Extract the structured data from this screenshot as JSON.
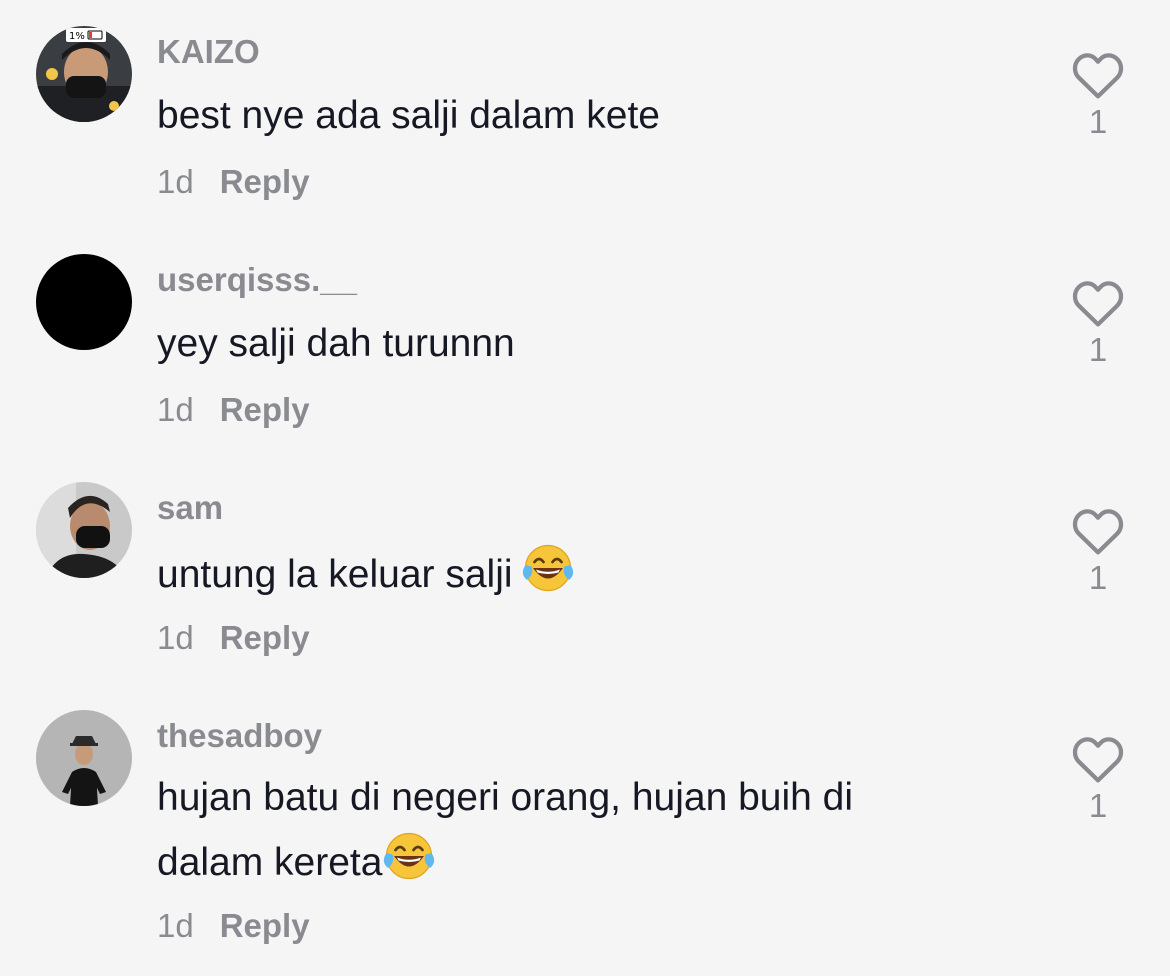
{
  "comments": [
    {
      "username": "KAIZO",
      "text": "best nye ada salji dalam kete",
      "age": "1d",
      "reply_label": "Reply",
      "likes": "1",
      "avatar_badge": "1%"
    },
    {
      "username": "userqisss.__",
      "text": "yey salji dah turunnn",
      "age": "1d",
      "reply_label": "Reply",
      "likes": "1"
    },
    {
      "username": "sam",
      "text": "untung la keluar salji",
      "emoji": "face-with-tears-of-joy",
      "age": "1d",
      "reply_label": "Reply",
      "likes": "1"
    },
    {
      "username": "thesadboy",
      "text_line1": "hujan batu di negeri orang, hujan buih di",
      "text_line2": "dalam kereta",
      "emoji": "face-with-tears-of-joy",
      "age": "1d",
      "reply_label": "Reply",
      "likes": "1"
    }
  ],
  "icons": {
    "like": "heart-outline-icon",
    "emoji": "face-with-tears-of-joy"
  },
  "colors": {
    "background": "#f5f5f5",
    "primary_text": "#161823",
    "secondary_text": "#8a8b91"
  }
}
